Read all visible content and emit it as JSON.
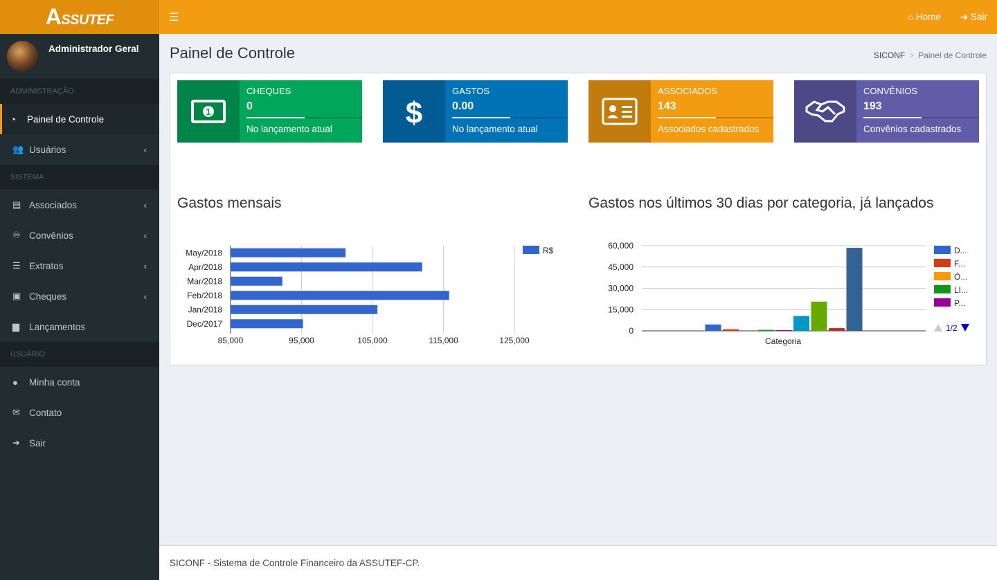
{
  "brand": {
    "logo_text": "ASSUTEF",
    "logo_initial": "A",
    "logo_rest": "SSUTEF"
  },
  "user": {
    "name": "Administrador Geral"
  },
  "sidebar": {
    "sections": [
      {
        "header": "ADMINISTRAÇÃO"
      },
      {
        "header": "SISTEMA"
      },
      {
        "header": "USUÁRIO"
      }
    ],
    "items": [
      {
        "label": "Painel de Controle",
        "icon": "dashboard-icon",
        "active": true
      },
      {
        "label": "Usuários",
        "icon": "users-icon",
        "arrow": true
      },
      {
        "label": "Associados",
        "icon": "id-card-icon",
        "arrow": true
      },
      {
        "label": "Convênios",
        "icon": "handshake-icon",
        "arrow": true
      },
      {
        "label": "Extratos",
        "icon": "list-icon",
        "arrow": true
      },
      {
        "label": "Cheques",
        "icon": "money-icon",
        "arrow": true
      },
      {
        "label": "Lançamentos",
        "icon": "file-icon"
      },
      {
        "label": "Minha conta",
        "icon": "user-icon"
      },
      {
        "label": "Contato",
        "icon": "envelope-icon"
      },
      {
        "label": "Sair",
        "icon": "sign-out-icon"
      }
    ]
  },
  "topbar": {
    "home": "Home",
    "logout": "Sair"
  },
  "page": {
    "title": "Painel de Controle"
  },
  "breadcrumb": {
    "root": "SICONF",
    "current": "Painel de Controle"
  },
  "info_boxes": [
    {
      "label": "CHEQUES",
      "value": "0",
      "desc": "No lançamento atual",
      "color": "#00a65a",
      "icon": "money-bill-icon"
    },
    {
      "label": "GASTOS",
      "value": "0.00",
      "desc": "No lançamento atual",
      "color": "#0073b7",
      "icon": "dollar-icon"
    },
    {
      "label": "ASSOCIADOS",
      "value": "143",
      "desc": "Associados cadastrados",
      "color": "#f39c12",
      "icon": "id-card-icon"
    },
    {
      "label": "CONVÊNIOS",
      "value": "193",
      "desc": "Convênios cadastrados",
      "color": "#605ca8",
      "icon": "handshake-icon"
    }
  ],
  "charts": {
    "monthly_title": "Gastos mensais",
    "category_title": "Gastos nos últimos 30 dias por categoria, já lançados"
  },
  "chart_data": [
    {
      "type": "bar",
      "orientation": "horizontal",
      "title": "Gastos mensais",
      "categories": [
        "May/2018",
        "Apr/2018",
        "Mar/2018",
        "Feb/2018",
        "Jan/2018",
        "Dec/2017"
      ],
      "series": [
        {
          "name": "R$",
          "values": [
            101200,
            112000,
            92300,
            115800,
            105700,
            95200
          ],
          "color": "#3366cc"
        }
      ],
      "xlim": [
        85000,
        125000
      ],
      "xticks": [
        "85,000",
        "95,000",
        "105,000",
        "115,000",
        "125,000"
      ],
      "grid": true,
      "legend": "right"
    },
    {
      "type": "bar",
      "title": "Gastos nos últimos 30 dias por categoria, já lançados",
      "xlabel": "Categoria",
      "ylim": [
        0,
        60000
      ],
      "yticks": [
        "0",
        "15,000",
        "30,000",
        "45,000",
        "60,000"
      ],
      "series": [
        {
          "value": 4500,
          "color": "#3366cc"
        },
        {
          "value": 1100,
          "color": "#dc3912"
        },
        {
          "value": 0,
          "color": "#ff9900"
        },
        {
          "value": 700,
          "color": "#109618"
        },
        {
          "value": 500,
          "color": "#990099"
        },
        {
          "value": 10500,
          "color": "#0099c6"
        },
        {
          "value": 20600,
          "color": "#66aa00"
        },
        {
          "value": 1900,
          "color": "#b82e2e"
        },
        {
          "value": 58500,
          "color": "#316395"
        }
      ],
      "legend_entries": [
        {
          "label": "D...",
          "color": "#3366cc"
        },
        {
          "label": "F...",
          "color": "#dc3912"
        },
        {
          "label": "Ó...",
          "color": "#ff9900"
        },
        {
          "label": "LI...",
          "color": "#109618"
        },
        {
          "label": "P...",
          "color": "#990099"
        }
      ],
      "legend_page": "1/2",
      "grid": true,
      "legend": "right"
    }
  ],
  "footer": {
    "text": "SICONF - Sistema de Controle Financeiro da ASSUTEF-CP."
  }
}
